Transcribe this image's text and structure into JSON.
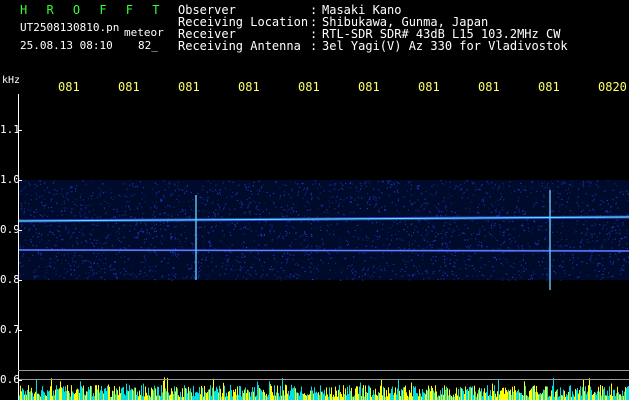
{
  "header": {
    "title": "H R O F F T",
    "filename": "UT2508130810.pn",
    "tag": "meteor",
    "datetime": "25.08.13 08:10",
    "count": "82_"
  },
  "info": [
    {
      "label": "Observer",
      "value": "Masaki Kano"
    },
    {
      "label": "Receiving Location",
      "value": "Shibukawa, Gunma, Japan"
    },
    {
      "label": "Receiver",
      "value": "RTL-SDR SDR# 43dB L15 103.2MHz CW"
    },
    {
      "label": "Receiving Antenna",
      "value": "3el Yagi(V) Az 330 for Vladivostok"
    }
  ],
  "chart_data": {
    "type": "heatmap",
    "ylabel": "kHz",
    "x_ticks": [
      "081",
      "081",
      "081",
      "081",
      "081",
      "081",
      "081",
      "081",
      "081",
      "0820"
    ],
    "y_ticks": [
      "1.1",
      "1.0",
      "0.9",
      "0.8",
      "0.7",
      "0.6"
    ],
    "ylim": [
      0.6,
      1.1
    ],
    "traces": [
      {
        "freq_khz": 0.92,
        "description": "strong carrier"
      },
      {
        "freq_khz": 0.86,
        "description": "secondary carrier"
      }
    ],
    "events": [
      {
        "time_index": 2.3,
        "freq_range_khz": [
          0.8,
          0.97
        ]
      },
      {
        "time_index": 8.2,
        "freq_range_khz": [
          0.78,
          0.98
        ]
      }
    ],
    "colors": {
      "axis": "#ffffff",
      "ticks": "#ffff66",
      "signal": "#3355ff",
      "peak": "#66ffdd",
      "noise_bars": "#ffff00"
    }
  }
}
